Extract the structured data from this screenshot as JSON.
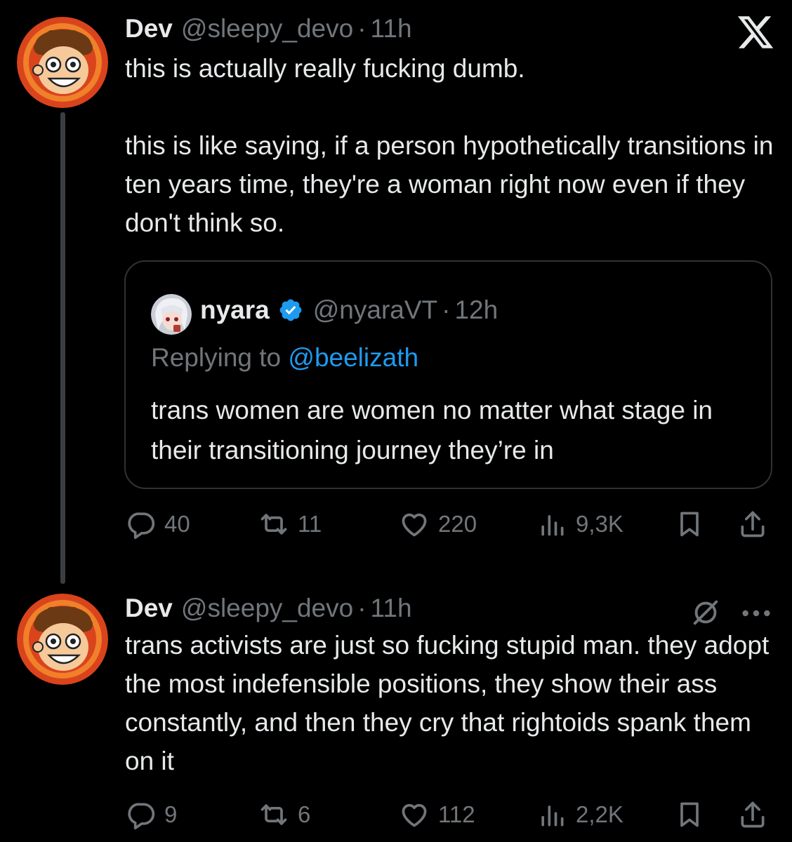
{
  "tweets": [
    {
      "author_name": "Dev",
      "author_handle": "@sleepy_devo",
      "separator": "·",
      "time": "11h",
      "text": "this is actually really fucking dumb.\n\nthis is like saying, if a person hypothetically transitions in ten years time, they're a woman right now even if they don't think so.",
      "quote": {
        "author_name": "nyara",
        "verified": true,
        "author_handle": "@nyaraVT",
        "separator": "·",
        "time": "12h",
        "replying_prefix": "Replying to ",
        "replying_to": "@beelizath",
        "text": "trans women are women no matter what stage in their transitioning journey they’re in"
      },
      "stats": {
        "replies": "40",
        "retweets": "11",
        "likes": "220",
        "views": "9,3K"
      }
    },
    {
      "author_name": "Dev",
      "author_handle": "@sleepy_devo",
      "separator": "·",
      "time": "11h",
      "text": "trans activists are just so fucking stupid man. they adopt the most indefensible positions, they show their ass constantly, and then they cry that rightoids spank them on it",
      "stats": {
        "replies": "9",
        "retweets": "6",
        "likes": "112",
        "views": "2,2K"
      }
    }
  ],
  "icons": {
    "app_logo": "x-logo-icon",
    "reply": "speech-bubble-icon",
    "retweet": "retweet-icon",
    "like": "heart-icon",
    "views": "bar-chart-icon",
    "bookmark": "bookmark-icon",
    "share": "share-icon",
    "mute": "mute-icon",
    "more": "more-icon",
    "verified": "verified-badge-icon"
  },
  "colors": {
    "background": "#000000",
    "text": "#e7e9ea",
    "secondary": "#71767b",
    "link": "#1d9bf0",
    "border": "#2f3336",
    "verified": "#1d9bf0"
  }
}
